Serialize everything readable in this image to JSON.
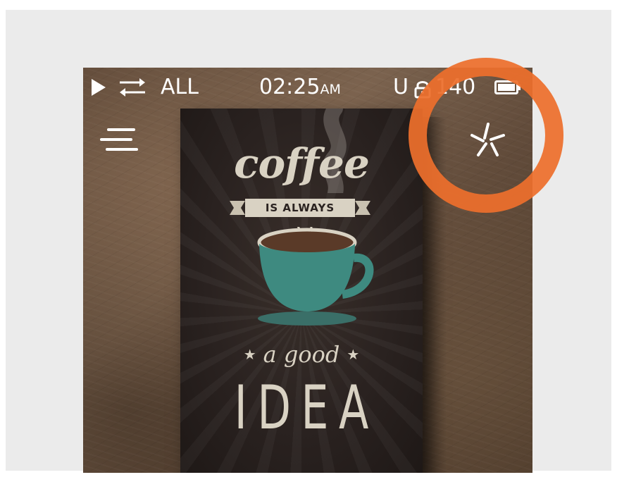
{
  "status_bar": {
    "play_icon": "play-icon",
    "repeat_icon": "repeat-icon",
    "repeat_mode": "ALL",
    "time": "02:25",
    "time_suffix": "AM",
    "usb_mode": "U",
    "lock_icon": "lock-icon",
    "volume": "140",
    "battery_icon": "battery-icon"
  },
  "toolbar": {
    "menu_icon": "menu-icon",
    "effects_icon": "star-effects-icon"
  },
  "album_art": {
    "line1": "coffee",
    "banner": "IS ALWAYS",
    "line3": "a good",
    "line3_stars": "★",
    "line4": "IDEA"
  },
  "annotation": {
    "highlight": "orange-circle",
    "color": "#ED6F2C"
  },
  "colors": {
    "page_background": "#EBEBEB",
    "status_text": "#FFFFFF",
    "poster_text": "#D9D2C3",
    "cup": "#3E8A80"
  }
}
